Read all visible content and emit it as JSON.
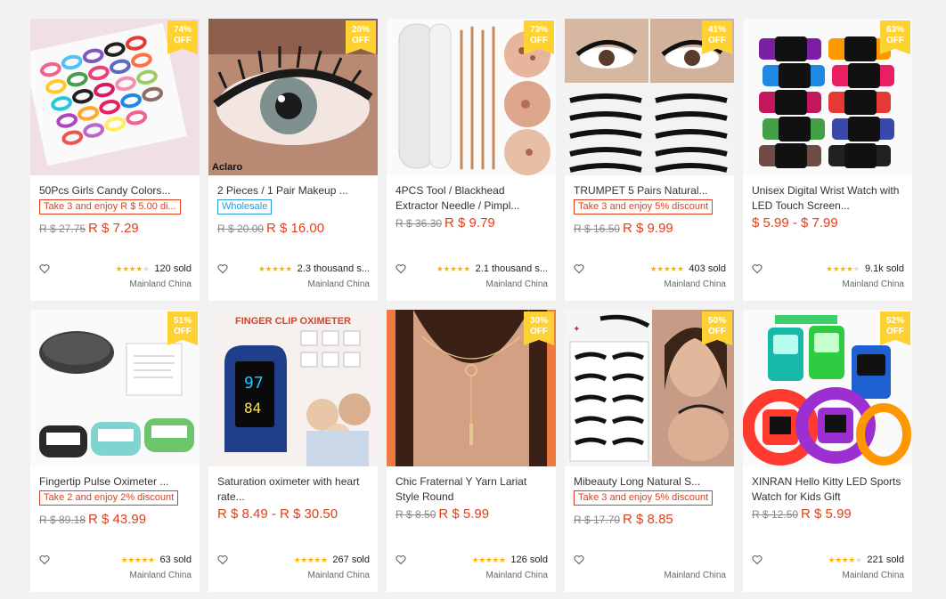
{
  "products": [
    {
      "discount": "74%",
      "off": "OFF",
      "title": "50Pcs Girls Candy Colors...",
      "promo": "Take 3 and enjoy R $ 5.00 di...",
      "promo_style": "red",
      "old_price": "R $ 27.75",
      "price": "R $ 7.29",
      "rating_stars": 4,
      "sold": "120 sold",
      "location": "Mainland China"
    },
    {
      "discount": "20%",
      "off": "OFF",
      "title": "2 Pieces / 1 Pair Makeup ...",
      "promo": "Wholesale",
      "promo_style": "blue",
      "old_price": "R $ 20.00",
      "price": "R $ 16.00",
      "rating_stars": 5,
      "sold": "2.3 thousand s...",
      "location": "Mainland China",
      "image_text": "Aclaro"
    },
    {
      "discount": "73%",
      "off": "OFF",
      "title": "4PCS Tool / Blackhead Extractor Needle / Pimpl...",
      "promo": "",
      "promo_style": "",
      "old_price": "R $ 36.30",
      "price": "R $ 9.79",
      "rating_stars": 5,
      "sold": "2.1 thousand s...",
      "location": "Mainland China"
    },
    {
      "discount": "41%",
      "off": "OFF",
      "title": "TRUMPET 5 Pairs Natural...",
      "promo": "Take 3 and enjoy 5% discount",
      "promo_style": "red",
      "old_price": "R $ 16.50",
      "price": "R $ 9.99",
      "rating_stars": 5,
      "sold": "403 sold",
      "location": "Mainland China"
    },
    {
      "discount": "63%",
      "off": "OFF",
      "title": "Unisex Digital Wrist Watch with LED Touch Screen...",
      "promo": "",
      "promo_style": "",
      "old_price": "",
      "price": "$ 5.99 - $ 7.99",
      "rating_stars": 4,
      "sold": "9.1k sold",
      "location": "Mainland China"
    },
    {
      "discount": "51%",
      "off": "OFF",
      "title": "Fingertip Pulse Oximeter ...",
      "promo": "Take 2 and enjoy 2% discount",
      "promo_style": "red",
      "old_price": "R $ 89.18",
      "price": "R $ 43.99",
      "rating_stars": 5,
      "sold": "63 sold",
      "location": "Mainland China"
    },
    {
      "discount": "",
      "off": "",
      "title": "Saturation oximeter with heart rate...",
      "promo": "",
      "promo_style": "",
      "old_price": "",
      "price": "R $ 8.49 - R $ 30.50",
      "rating_stars": 5,
      "sold": "267 sold",
      "location": "Mainland China",
      "image_text": "FINGER CLIP OXIMETER",
      "screen_a": "97",
      "screen_b": "84"
    },
    {
      "discount": "30%",
      "off": "OFF",
      "title": "Chic Fraternal Y Yarn Lariat Style Round",
      "promo": "",
      "promo_style": "",
      "old_price": "R $ 8.50",
      "price": "R $ 5.99",
      "rating_stars": 5,
      "sold": "126 sold",
      "location": "Mainland China"
    },
    {
      "discount": "50%",
      "off": "OFF",
      "title": "Mibeauty Long Natural S...",
      "promo": "Take 3 and enjoy 5% discount",
      "promo_style": "red",
      "old_price": "R $ 17.70",
      "price": "R $ 8.85",
      "rating_stars": 0,
      "sold": "",
      "location": "Mainland China"
    },
    {
      "discount": "52%",
      "off": "OFF",
      "title": "XINRAN Hello Kitty LED Sports Watch for Kids Gift",
      "promo": "",
      "promo_style": "",
      "old_price": "R $ 12.50",
      "price": "R $ 5.99",
      "rating_stars": 4,
      "sold": "221 sold",
      "location": "Mainland China"
    }
  ],
  "icons": {
    "wishlist": "heart-outline-icon",
    "rating": "star-icon"
  },
  "colors": {
    "price": "#e0401d",
    "badge": "#ffd233",
    "promo_blue": "#2b9ad8",
    "stars": "#ffb400"
  }
}
